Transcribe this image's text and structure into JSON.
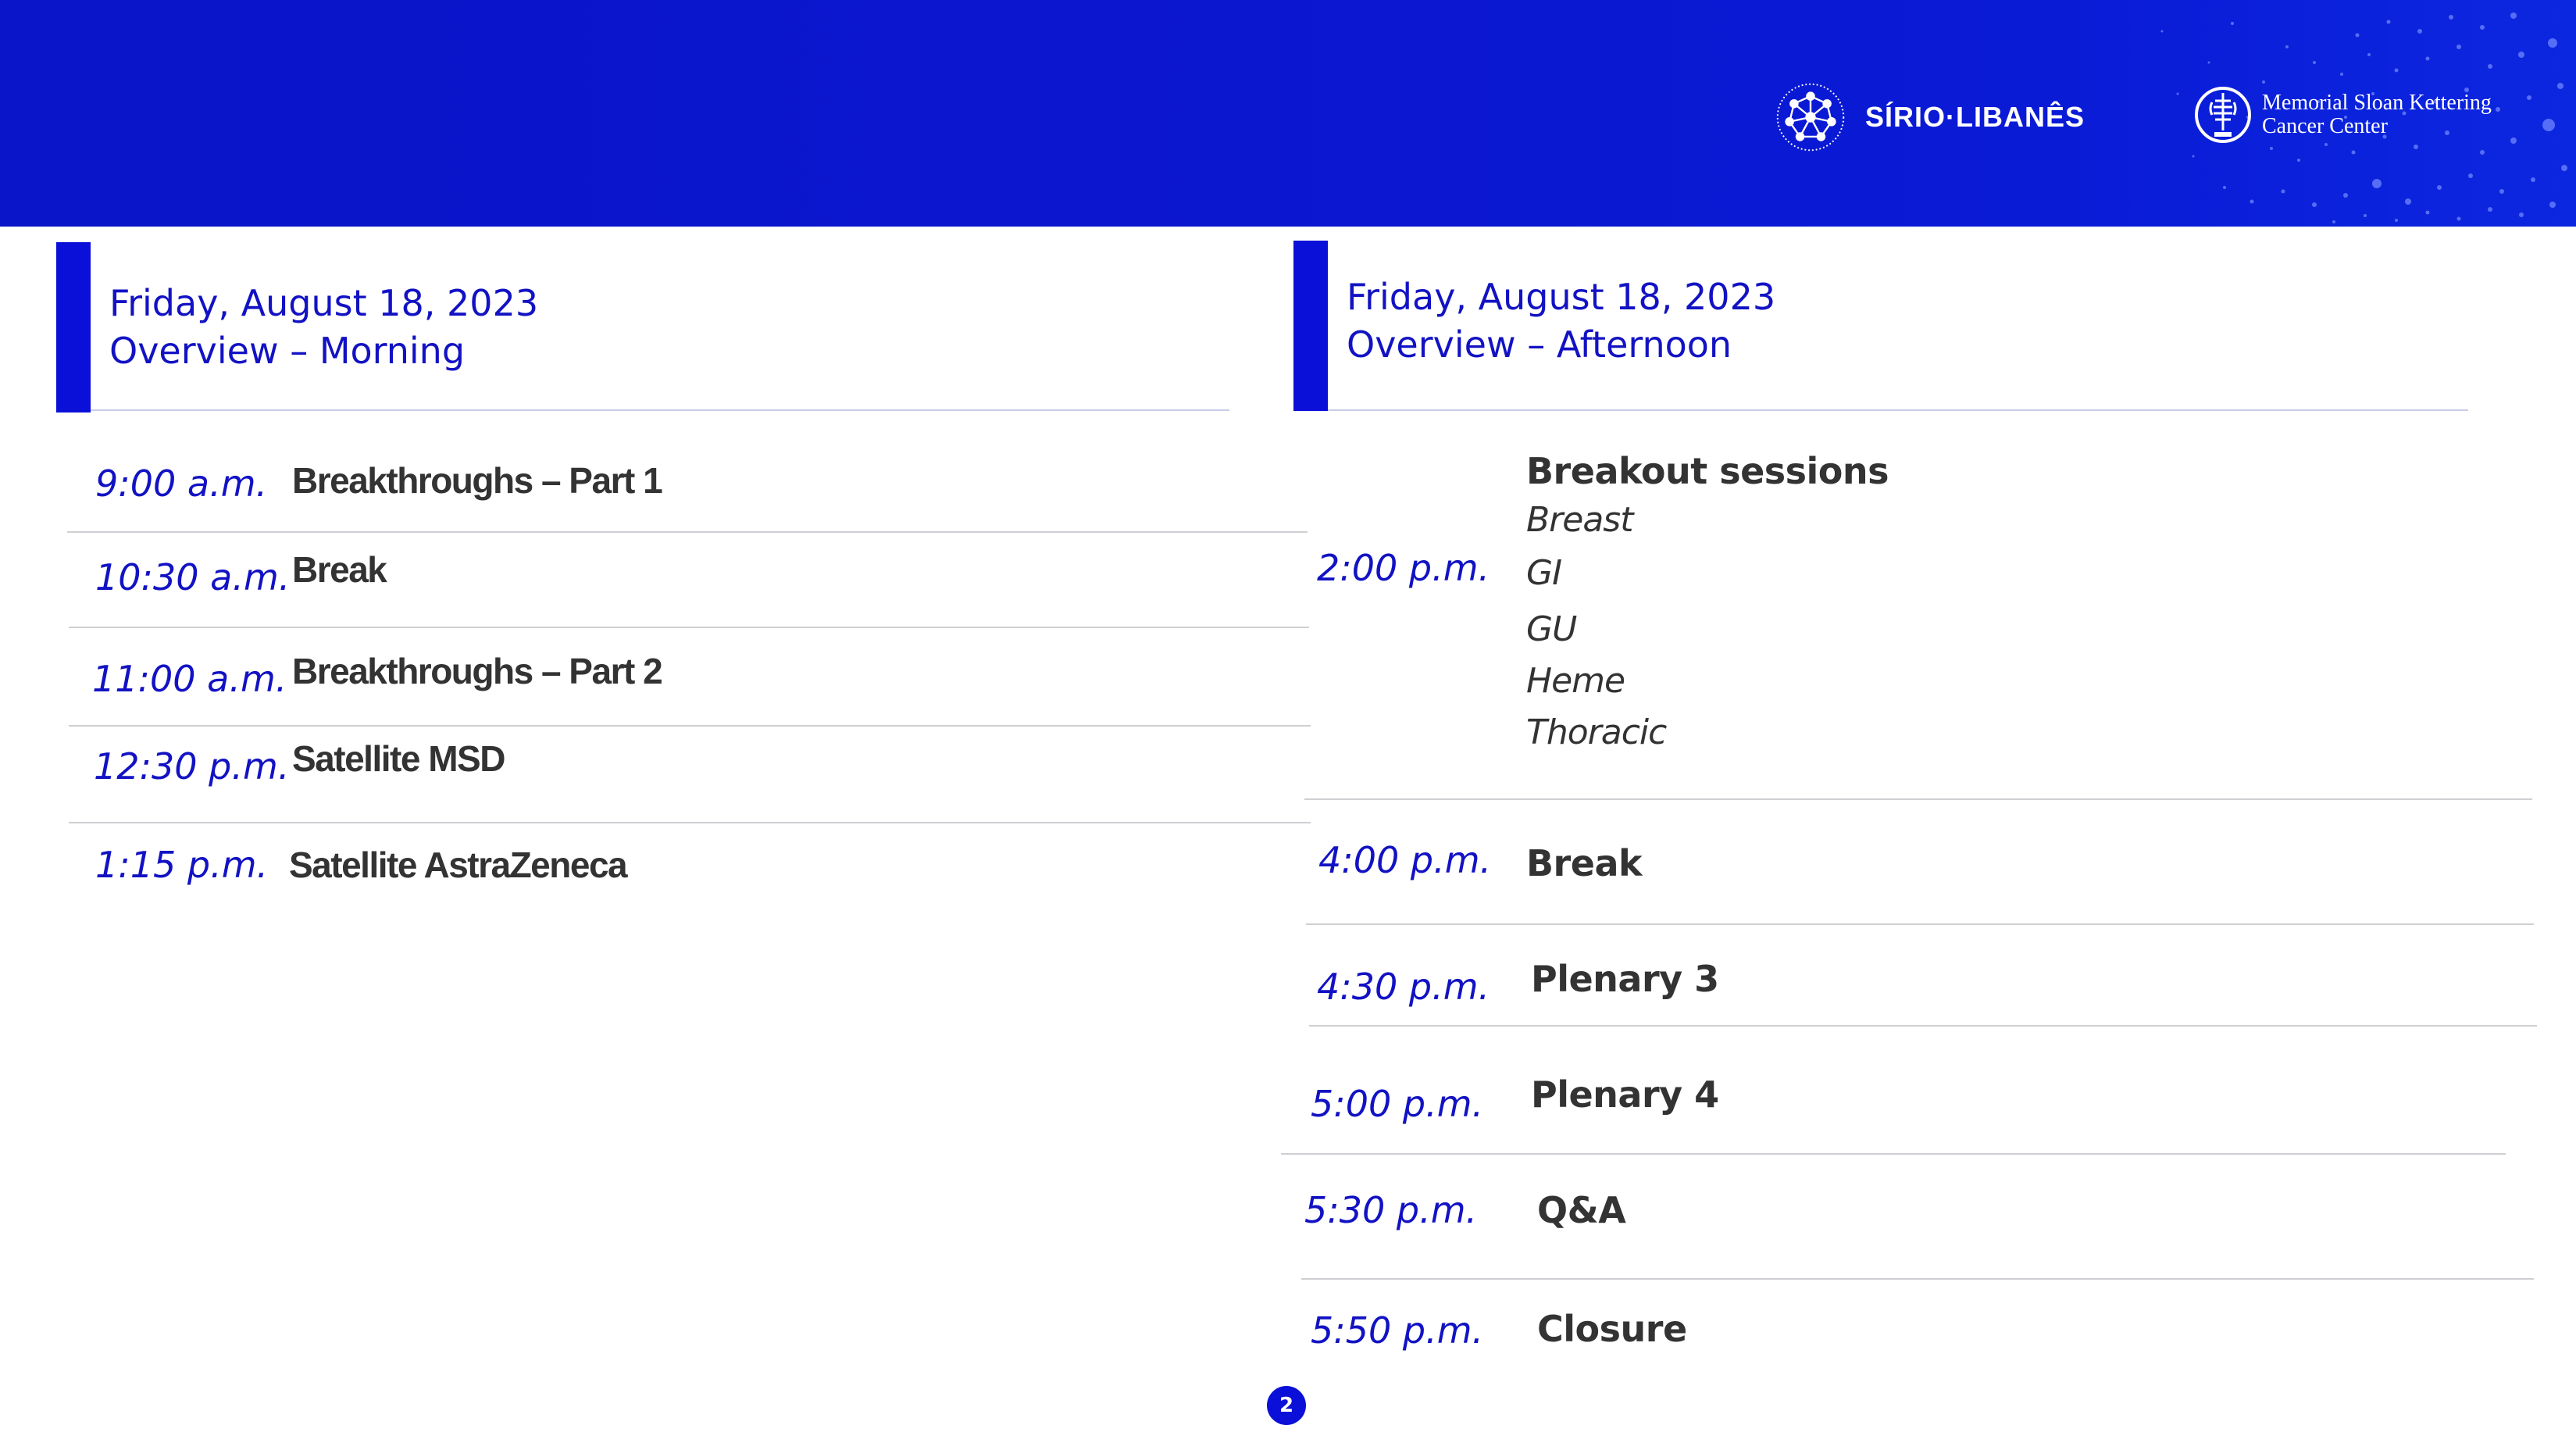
{
  "header": {
    "logo_left_text": "SÍRIO·LIBANÊS",
    "logo_right_line1": "Memorial Sloan Kettering",
    "logo_right_line2": "Cancer Center",
    "color": "#0a14c8"
  },
  "morning": {
    "title_line1": "Friday, August 18, 2023",
    "title_line2": "Overview – Morning",
    "items": [
      {
        "time": "9:00 a.m.",
        "event": "Breakthroughs – Part 1"
      },
      {
        "time": "10:30 a.m.",
        "event": "Break"
      },
      {
        "time": "11:00 a.m.",
        "event": "Breakthroughs – Part 2"
      },
      {
        "time": "12:30 p.m.",
        "event": "Satellite MSD"
      },
      {
        "time": "1:15 p.m.",
        "event": "Satellite AstraZeneca"
      }
    ]
  },
  "afternoon": {
    "title_line1": "Friday, August 18, 2023",
    "title_line2": "Overview – Afternoon",
    "breakout": {
      "time": "2:00 p.m.",
      "event": "Breakout sessions",
      "sessions": [
        "Breast",
        "GI",
        "GU",
        "Heme",
        "Thoracic"
      ]
    },
    "items": [
      {
        "time": "4:00 p.m.",
        "event": "Break"
      },
      {
        "time": "4:30 p.m.",
        "event": "Plenary 3"
      },
      {
        "time": "5:00 p.m.",
        "event": "Plenary 4"
      },
      {
        "time": "5:30 p.m.",
        "event": "Q&A"
      },
      {
        "time": "5:50 p.m.",
        "event": "Closure"
      }
    ]
  },
  "page_number": "2"
}
